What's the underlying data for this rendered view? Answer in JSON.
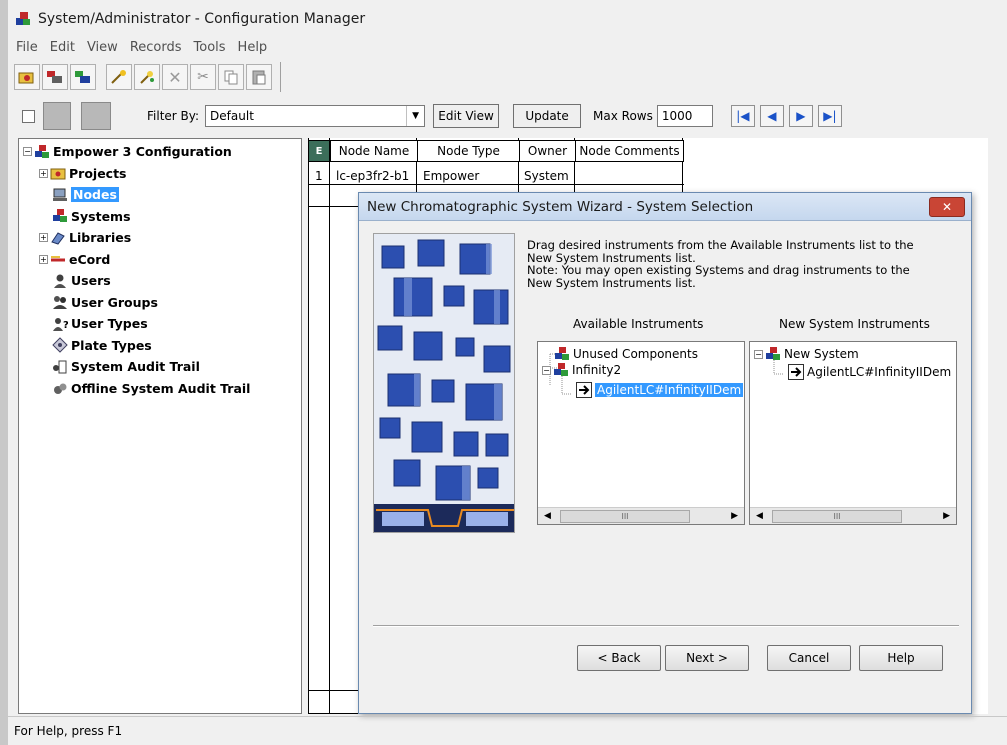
{
  "window": {
    "title": "System/Administrator - Configuration Manager"
  },
  "menu": [
    "File",
    "Edit",
    "View",
    "Records",
    "Tools",
    "Help"
  ],
  "filterbar": {
    "filter_label": "Filter By:",
    "filter_value": "Default",
    "edit_view": "Edit View",
    "update": "Update",
    "max_rows_label": "Max Rows",
    "max_rows_value": "1000"
  },
  "tree": {
    "root": "Empower 3 Configuration",
    "items": [
      "Projects",
      "Nodes",
      "Systems",
      "Libraries",
      "eCord",
      "Users",
      "User Groups",
      "User Types",
      "Plate Types",
      "System Audit Trail",
      "Offline System Audit Trail"
    ],
    "selected": "Nodes"
  },
  "grid": {
    "columns": [
      "Node Name",
      "Node Type",
      "Owner",
      "Node Comments"
    ],
    "rows": [
      {
        "index": "1",
        "node_name": "lc-ep3fr2-b1",
        "node_type": "Empower",
        "owner": "System",
        "node_comments": ""
      }
    ]
  },
  "dialog": {
    "title": "New Chromatographic System Wizard - System Selection",
    "instructions": [
      "Drag desired instruments from the Available Instruments list to the",
      "New System Instruments list.",
      "Note:  You may open existing Systems and drag instruments to the",
      "New System Instruments list."
    ],
    "available_title": "Available Instruments",
    "new_title": "New System Instruments",
    "available_items": [
      "Unused Components",
      "Infinity2",
      "AgilentLC#InfinityIIDem"
    ],
    "new_items": [
      "New System",
      "AgilentLC#InfinityIIDem"
    ],
    "scroll_thumb": "III",
    "buttons": {
      "back": "< Back",
      "next": "Next >",
      "cancel": "Cancel",
      "help": "Help"
    }
  },
  "status": {
    "text": "For Help, press F1"
  },
  "colors": {
    "selection": "#3399ff",
    "close_button": "#c94535",
    "nav_arrows": "#1a52c8"
  }
}
